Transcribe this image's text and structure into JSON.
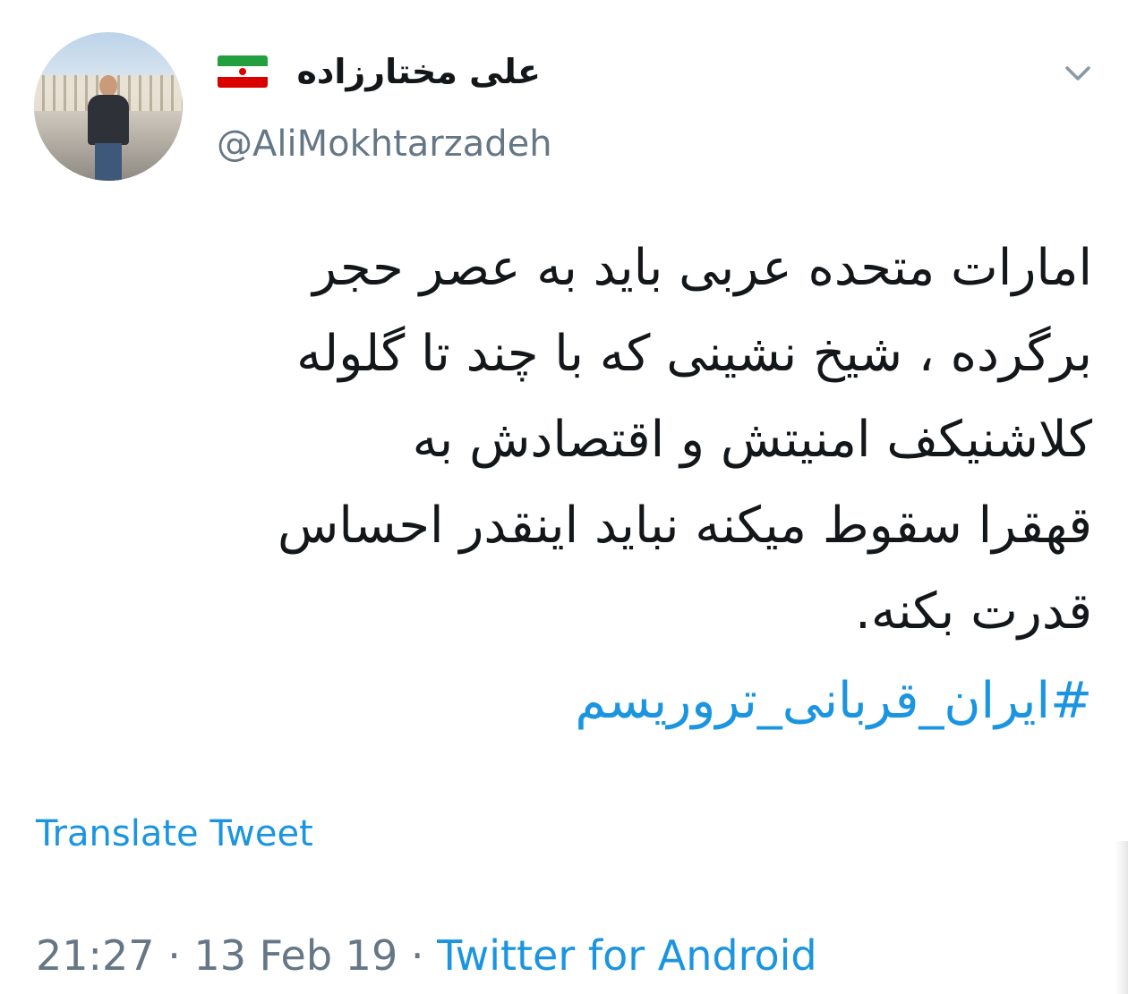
{
  "tweet": {
    "author": {
      "display_name": "علی مختارزاده",
      "handle": "@AliMokhtarzadeh",
      "flag_icon": "iran-flag-icon"
    },
    "menu_icon": "chevron-down-icon",
    "body_lines": [
      "امارات متحده عربی باید به عصر حجر",
      "برگرده ، شیخ نشینی که با چند تا گلوله",
      "کلاشنیکف امنیتش و اقتصادش به",
      "قهقرا سقوط میکنه نباید اینقدر احساس",
      "قدرت بکنه."
    ],
    "hashtag": "#ایران_قربانی_تروریسم",
    "translate_label": "Translate Tweet",
    "time": "21:27",
    "separator": "·",
    "date": "13 Feb 19",
    "source": "Twitter for Android"
  },
  "colors": {
    "link": "#1b95e0",
    "text": "#14171a",
    "muted": "#657786"
  }
}
